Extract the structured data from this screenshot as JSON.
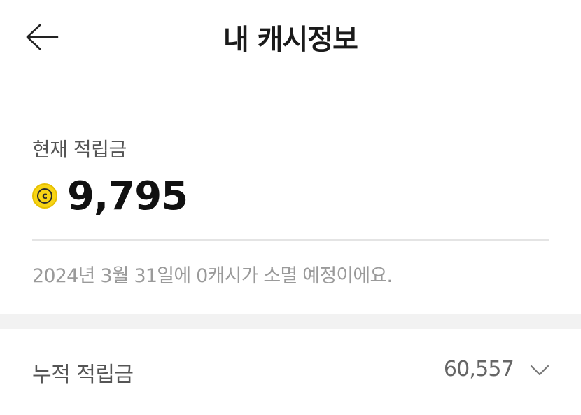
{
  "header": {
    "title": "내 캐시정보",
    "back_icon": "arrow-left-icon"
  },
  "current": {
    "label": "현재 적립금",
    "coin_icon": "cash-coin-icon",
    "coin_letter": "c",
    "amount": "9,795"
  },
  "expiry": {
    "note": "2024년 3월 31일에 0캐시가 소멸 예정이에요."
  },
  "cumulative": {
    "label": "누적 적립금",
    "amount": "60,557",
    "expand_icon": "chevron-down-icon"
  },
  "colors": {
    "coin_fill": "#f7d415",
    "section_gap": "#f2f2f2",
    "muted_text": "#9a9a9a"
  }
}
